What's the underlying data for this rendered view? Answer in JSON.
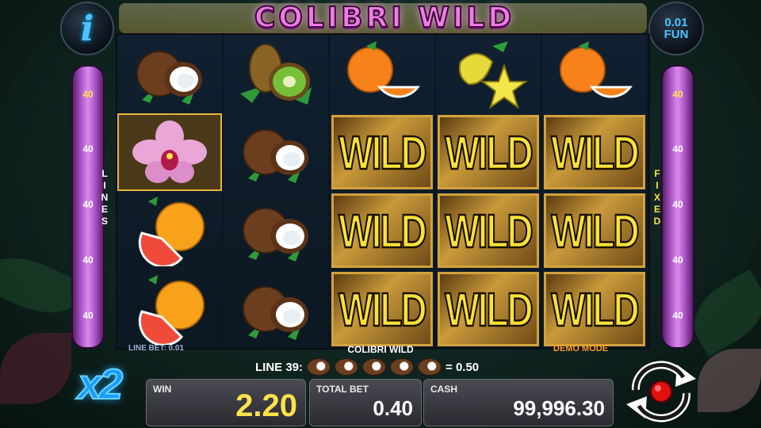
{
  "game": {
    "title": "COLIBRI WILD",
    "denomination": "0.01",
    "mode": "FUN"
  },
  "lines_panel": {
    "label_left": "LINES",
    "label_right": "FIXED",
    "left_values": [
      "40",
      "40",
      "40",
      "40",
      "40",
      "40"
    ],
    "right_values": [
      "40",
      "40",
      "40",
      "40",
      "40",
      "40"
    ]
  },
  "reels": [
    [
      "coconut",
      "orchid",
      "orange-slice",
      "orange-slice"
    ],
    [
      "kiwi",
      "coconut",
      "coconut",
      "coconut"
    ],
    [
      "orange",
      "wild",
      "wild",
      "wild"
    ],
    [
      "starfruit",
      "wild",
      "wild",
      "wild"
    ],
    [
      "orange",
      "wild",
      "wild",
      "wild"
    ]
  ],
  "wild_text": "WILD",
  "info_strip": {
    "line_bet": "LINE BET: 0.01",
    "game_name": "COLIBRI WILD",
    "demo": "DEMO MODE"
  },
  "win_line": {
    "label": "LINE 39:",
    "symbol": "coconut",
    "count": 5,
    "amount": "= 0.50"
  },
  "panels": {
    "win_label": "WIN",
    "win_value": "2.20",
    "total_bet_label": "TOTAL BET",
    "total_bet_value": "0.40",
    "cash_label": "CASH",
    "cash_value": "99,996.30"
  },
  "multiplier": "x2",
  "colors": {
    "accent_gold": "#ffe24a",
    "panel_purple": "#b45cd0",
    "title_pink": "#f07be6",
    "demo_orange": "#ff9a1f",
    "strip_blue": "#9ab4d8"
  }
}
